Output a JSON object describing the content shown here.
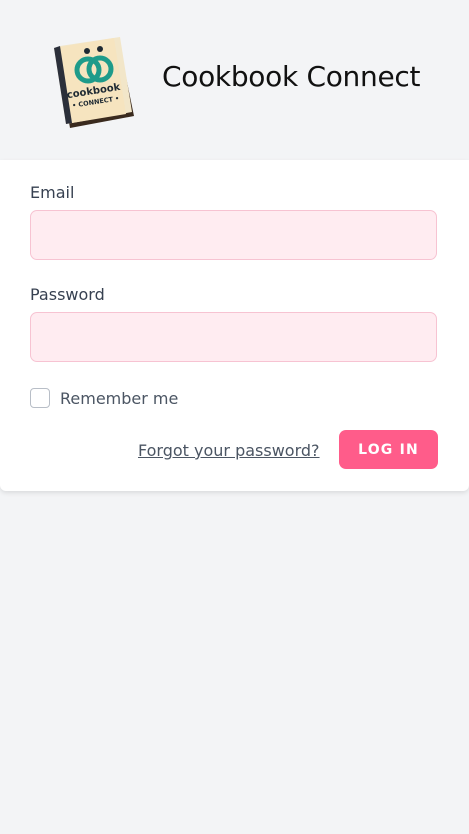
{
  "header": {
    "app_title": "Cookbook Connect",
    "logo": {
      "icon": "cookbook-logo",
      "line1": "cookbook",
      "line2": "• CONNECT •"
    }
  },
  "form": {
    "email_label": "Email",
    "email_value": "",
    "password_label": "Password",
    "password_value": "",
    "remember_label": "Remember me",
    "remember_checked": false,
    "forgot_link": "Forgot your password?",
    "login_button": "LOG IN"
  },
  "colors": {
    "background": "#f3f4f6",
    "card": "#ffffff",
    "input_fill": "#ffecf1",
    "input_border": "#f7c3d2",
    "accent": "#ff5c8a",
    "logo_ring": "#1e9b8a"
  }
}
